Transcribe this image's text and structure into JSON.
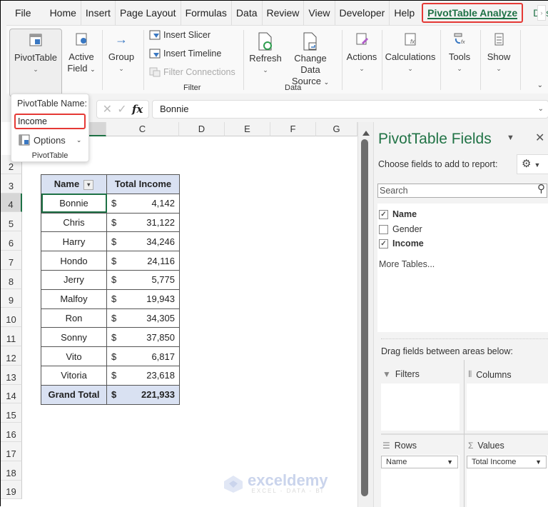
{
  "tabs": [
    {
      "label": "File"
    },
    {
      "label": "Home"
    },
    {
      "label": "Insert"
    },
    {
      "label": "Page Layout"
    },
    {
      "label": "Formulas"
    },
    {
      "label": "Data"
    },
    {
      "label": "Review"
    },
    {
      "label": "View"
    },
    {
      "label": "Developer"
    },
    {
      "label": "Help"
    },
    {
      "label": "PivotTable Analyze"
    },
    {
      "label": "Design"
    }
  ],
  "ribbon": {
    "pivottable": "PivotTable",
    "active_field_1": "Active",
    "active_field_2": "Field",
    "group": "Group",
    "insert_slicer": "Insert Slicer",
    "insert_timeline": "Insert Timeline",
    "filter_connections": "Filter Connections",
    "filter_group": "Filter",
    "refresh": "Refresh",
    "change_data_1": "Change Data",
    "change_data_2": "Source",
    "data_group": "Data",
    "actions": "Actions",
    "calculations": "Calculations",
    "tools": "Tools",
    "show": "Show"
  },
  "popup": {
    "name_label": "PivotTable Name:",
    "name_value": "Income",
    "options": "Options",
    "group": "PivotTable"
  },
  "formula_bar": {
    "value": "Bonnie"
  },
  "columns": [
    "C",
    "D",
    "E",
    "F",
    "G"
  ],
  "rows": [
    "2",
    "3",
    "4",
    "5",
    "6",
    "7",
    "8",
    "9",
    "10",
    "11",
    "12",
    "13",
    "14",
    "15",
    "16",
    "17",
    "18",
    "19"
  ],
  "pivot": {
    "headers": [
      "Name",
      "Total Income"
    ],
    "currency": "$",
    "rows": [
      {
        "name": "Bonnie",
        "value": "4,142"
      },
      {
        "name": "Chris",
        "value": "31,122"
      },
      {
        "name": "Harry",
        "value": "34,246"
      },
      {
        "name": "Hondo",
        "value": "24,116"
      },
      {
        "name": "Jerry",
        "value": "5,775"
      },
      {
        "name": "Malfoy",
        "value": "19,943"
      },
      {
        "name": "Ron",
        "value": "34,305"
      },
      {
        "name": "Sonny",
        "value": "37,850"
      },
      {
        "name": "Vito",
        "value": "6,817"
      },
      {
        "name": "Vitoria",
        "value": "23,618"
      }
    ],
    "total_label": "Grand Total",
    "total_value": "221,933"
  },
  "pane": {
    "title": "PivotTable Fields",
    "choose": "Choose fields to add to report:",
    "search_placeholder": "Search",
    "fields": [
      {
        "label": "Name",
        "checked": true
      },
      {
        "label": "Gender",
        "checked": false
      },
      {
        "label": "Income",
        "checked": true
      }
    ],
    "more_tables": "More Tables...",
    "drag_label": "Drag fields between areas below:",
    "filters": "Filters",
    "columns": "Columns",
    "rows": "Rows",
    "values": "Values",
    "rows_chip": "Name",
    "values_chip": "Total Income"
  },
  "watermark": {
    "title": "exceldemy",
    "sub": "EXCEL - DATA - BI"
  }
}
